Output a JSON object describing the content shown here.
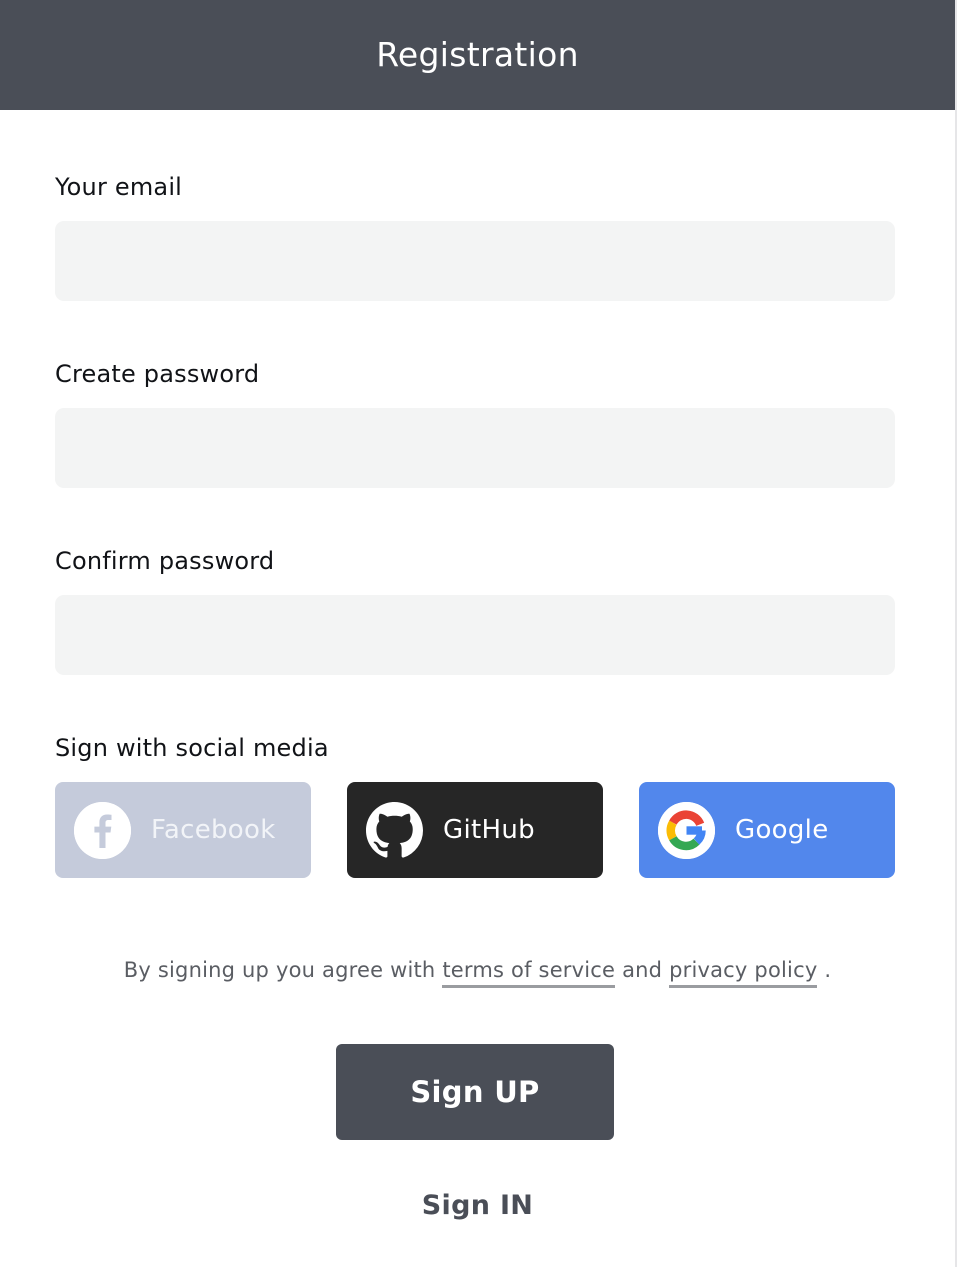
{
  "header": {
    "title": "Registration"
  },
  "form": {
    "email": {
      "label": "Your email",
      "value": "",
      "placeholder": ""
    },
    "password": {
      "label": "Create password",
      "value": "",
      "placeholder": ""
    },
    "confirm": {
      "label": "Confirm password",
      "value": "",
      "placeholder": ""
    }
  },
  "social": {
    "heading": "Sign with social media",
    "facebook": {
      "label": "Facebook",
      "icon": "facebook-icon",
      "color": "#c5cbdb"
    },
    "github": {
      "label": "GitHub",
      "icon": "github-icon",
      "color": "#262626"
    },
    "google": {
      "label": "Google",
      "icon": "google-icon",
      "color": "#5287ec"
    }
  },
  "agreement": {
    "prefix": "By signing up you agree with",
    "terms_link": "terms of service",
    "middle": "and",
    "privacy_link": "privacy policy",
    "suffix": "."
  },
  "actions": {
    "signup_label": "Sign UP",
    "signin_label": "Sign IN"
  },
  "colors": {
    "header_bg": "#4a4e57",
    "input_bg": "#f3f4f4",
    "primary_button": "#4a4e57"
  }
}
